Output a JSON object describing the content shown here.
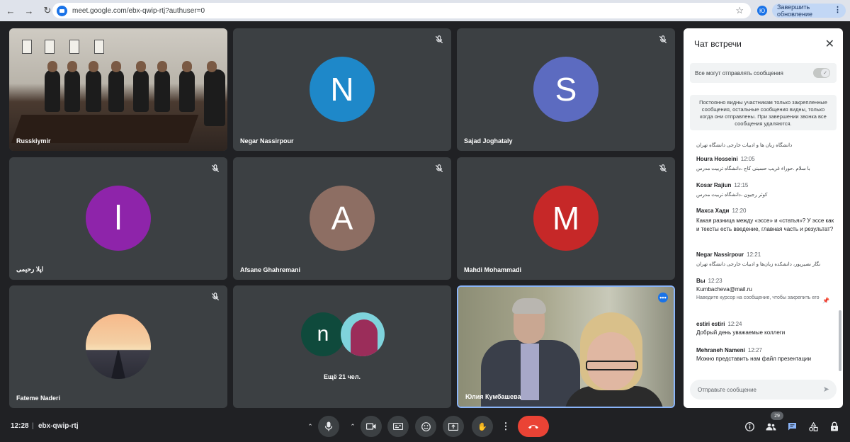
{
  "browser": {
    "url": "meet.google.com/ebx-qwip-rtj?authuser=0",
    "profile_initial": "Ю",
    "update_label": "Завершить обновление"
  },
  "tiles": [
    {
      "name": "Russkiymir",
      "kind": "video-room",
      "muted": false
    },
    {
      "name": "Negar Nassirpour",
      "initial": "N",
      "color": "#1e88c9",
      "muted": true
    },
    {
      "name": "Sajad Joghataly",
      "initial": "S",
      "color": "#5c6bc0",
      "muted": true
    },
    {
      "name": "اپلا رحیمی",
      "initial": "ا",
      "color": "#8e24aa",
      "muted": true
    },
    {
      "name": "Afsane Ghahremani",
      "initial": "A",
      "color": "#8d6e63",
      "muted": true
    },
    {
      "name": "Mahdi Mohammadi",
      "initial": "M",
      "color": "#c62828",
      "muted": true
    },
    {
      "name": "Fateme Naderi",
      "kind": "sunset",
      "muted": true
    },
    {
      "name": "Ещё 21 чел.",
      "kind": "more",
      "initial": "n"
    },
    {
      "name": "Юлия Кумбашева",
      "kind": "video-speaker",
      "muted": false
    }
  ],
  "chat": {
    "title": "Чат встречи",
    "permission_label": "Все могут отправлять сообщения",
    "notice": "Постоянно видны участникам только закрепленные сообщения, остальные сообщения видны, только когда они отправлены. При завершении звонка все сообщения удаляются.",
    "messages": [
      {
        "author": "",
        "time": "",
        "text": "دانشگاه زبان ها و ادبیات خارجی دانشگاه تهران",
        "rtl": true
      },
      {
        "author": "Houra Hosseini",
        "time": "12:05",
        "text": "با سلام .حوراء غریب حسینی کاج ،دانشگاه تربیت مدرس",
        "rtl": true
      },
      {
        "author": "Kosar Rajiun",
        "time": "12:15",
        "text": "کوثر رجیون ،دانشگاه تربیت مدرس",
        "rtl": true
      },
      {
        "author": "Махса Хади",
        "time": "12:20",
        "text": "Какая разница между «эссе» и «статья»? У эссе как и тексты есть введение, главная часть и результат?",
        "rtl": false
      },
      {
        "author": "Negar Nassirpour",
        "time": "12:21",
        "text": "نگار نصیرپور، دانشکده زبان‌ها و ادبیات خارجی دانشگاه تهران",
        "rtl": true
      },
      {
        "author": "Вы",
        "time": "12:23",
        "text": "Kumbacheva@mail.ru",
        "hint": "Наведите курсор на сообщение, чтобы закрепить его",
        "rtl": false
      },
      {
        "author": "estiri estiri",
        "time": "12:24",
        "text": "Добрый день уважаемые коллеги",
        "rtl": false
      },
      {
        "author": "Mehraneh Nameni",
        "time": "12:27",
        "text": "Можно представить нам файл презентации",
        "rtl": false
      }
    ],
    "input_placeholder": "Отправьте сообщение"
  },
  "bottom": {
    "clock": "12:28",
    "separator": "|",
    "meeting_code": "ebx-qwip-rtj",
    "participants_count": "29"
  },
  "icons": {
    "mic_off": "mic-off-icon",
    "accent": "#1a73e8",
    "end_call": "#ea4335"
  }
}
